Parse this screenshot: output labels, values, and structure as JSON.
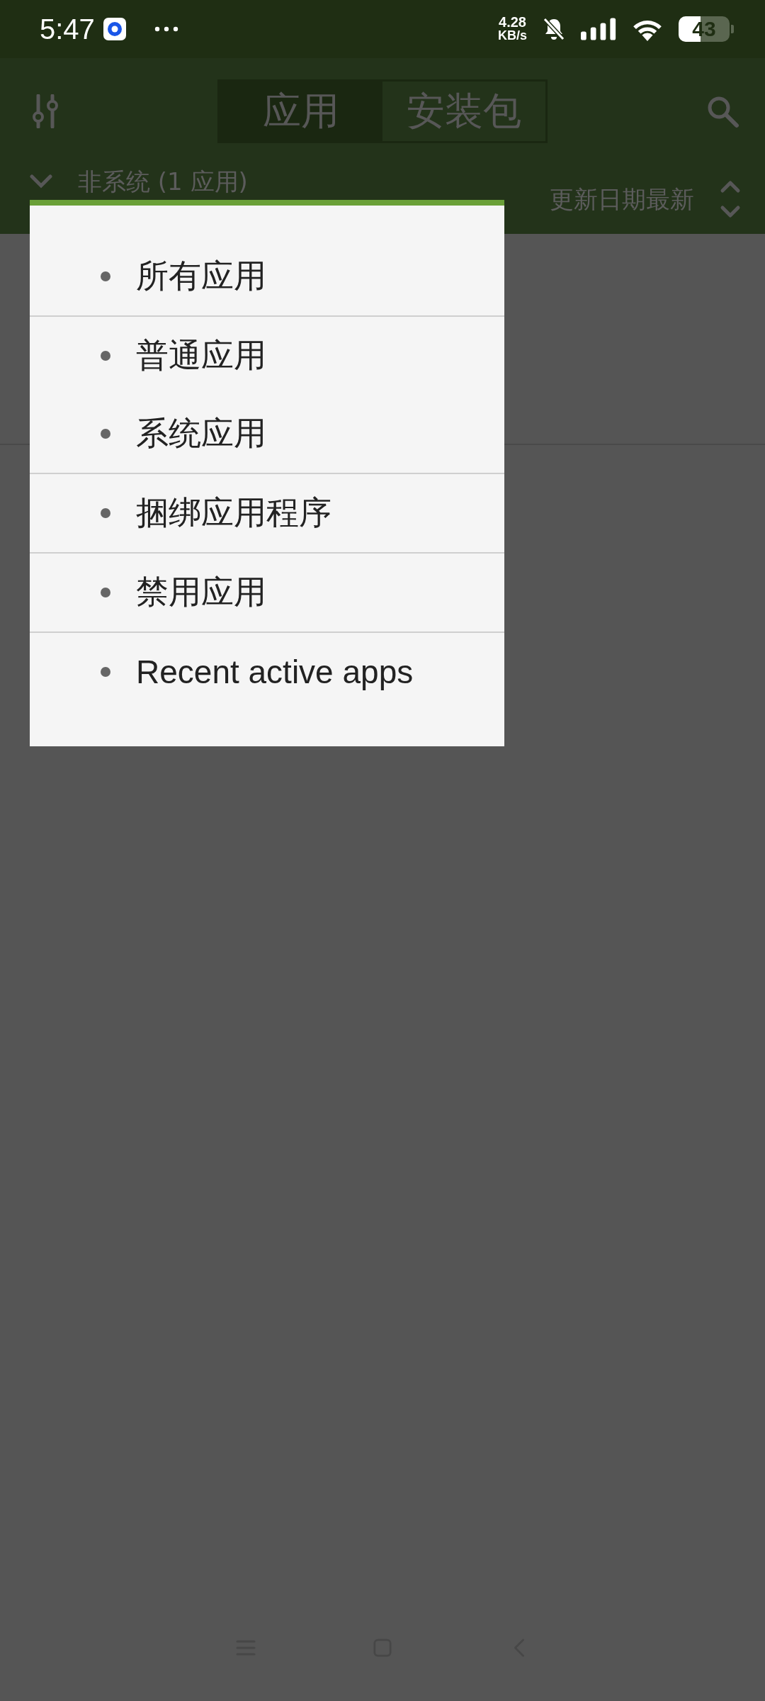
{
  "status_bar": {
    "time": "5:47",
    "net_speed_value": "4.28",
    "net_speed_unit": "KB/s",
    "battery": "43"
  },
  "toolbar": {
    "tabs": [
      {
        "label": "应用",
        "selected": true
      },
      {
        "label": "安装包",
        "selected": false
      }
    ]
  },
  "filter_bar": {
    "filter": "非系统 (1 应用)",
    "sort": "更新日期最新"
  },
  "filter_menu": {
    "groups": [
      [
        "所有应用"
      ],
      [
        "普通应用",
        "系统应用"
      ],
      [
        "捆绑应用程序"
      ],
      [
        "禁用应用"
      ],
      [
        "Recent active apps"
      ]
    ]
  }
}
